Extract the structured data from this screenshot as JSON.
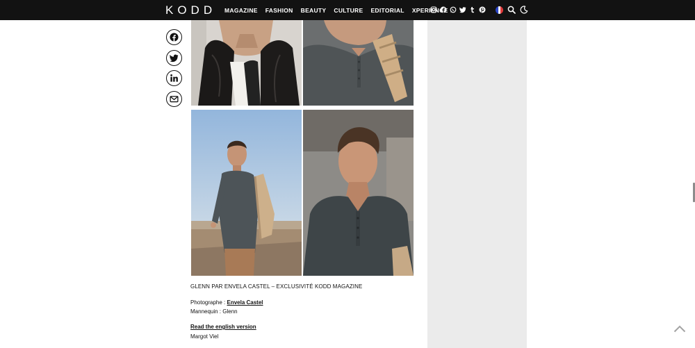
{
  "header": {
    "logo": "KODD",
    "nav": [
      "MAGAZINE",
      "FASHION",
      "BEAUTY",
      "CULTURE",
      "EDITORIAL",
      "XPERIENCE"
    ],
    "social_icons": [
      "instagram-icon",
      "facebook-icon",
      "whatsapp-icon",
      "twitter-icon",
      "tumblr-icon",
      "pinterest-icon"
    ],
    "language_flag": "fr",
    "tools": [
      "search-icon",
      "moon-icon"
    ]
  },
  "share": [
    "facebook-icon",
    "twitter-icon",
    "linkedin-icon",
    "mail-icon"
  ],
  "article": {
    "caption": "GLENN PAR ENVELA CASTEL – EXCLUSIVITÉ KODD MAGAZINE",
    "photographer_label": "Photographe : ",
    "photographer_name": "Envela Castel",
    "model_line": "Mannequin : Glenn",
    "english_link": "Read the english version",
    "author": "Margot Viel"
  },
  "colors": {
    "header_bg": "#121212",
    "sidebar_bg": "#ebebeb",
    "text": "#111111"
  }
}
